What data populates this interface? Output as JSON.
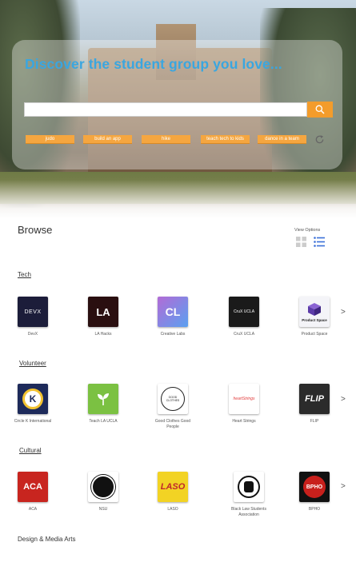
{
  "hero": {
    "headline": "Discover the student group you love...",
    "search_placeholder": "",
    "chips": [
      "judo",
      "build an app",
      "hike",
      "teach tech to kids",
      "dance in a team"
    ]
  },
  "browse": {
    "title": "Browse",
    "view_options_label": "View Options"
  },
  "categories": [
    {
      "title": "Tech",
      "groups": [
        "DevX",
        "LA Hacks",
        "Creative Labs",
        "CruX UCLA",
        "Product Space"
      ]
    },
    {
      "title": "Volunteer",
      "groups": [
        "Circle K International",
        "Teach LA UCLA",
        "Good Clothes Good People",
        "Heart Strings",
        "FLIP"
      ]
    },
    {
      "title": "Cultural",
      "groups": [
        "ACA",
        "NSU",
        "LASO",
        "Black Law Students Association",
        "BPHO"
      ]
    },
    {
      "title": "Design & Media Arts"
    }
  ],
  "logos": {
    "devx_text": "DEVX",
    "lahacks_text": "LA",
    "creativelabs_text": "CL",
    "crux_text": "CruX UCLA",
    "productspace_text": "Product Space",
    "circlek_text": "K",
    "gcgp_text": "GOOD CLOTHES",
    "heartstrings_text": "heartStrings",
    "flip_text": "FLIP",
    "aca_text": "ACA",
    "laso_text": "LASO",
    "bpho_text": "BPHO"
  },
  "next_arrow": ">",
  "colors": {
    "accent_blue": "#3aa6e0",
    "orange": "#f39c2b"
  }
}
